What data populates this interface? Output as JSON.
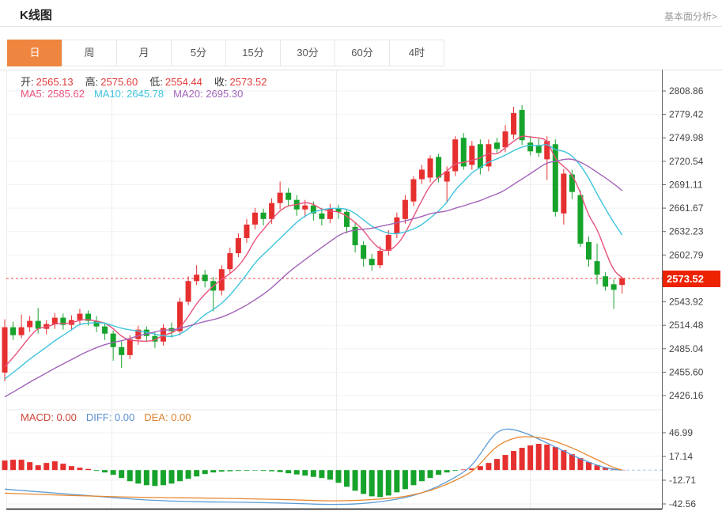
{
  "header": {
    "title": "K线图",
    "link": "基本面分析>"
  },
  "tabs": {
    "items": [
      "日",
      "周",
      "月",
      "5分",
      "15分",
      "30分",
      "60分",
      "4时"
    ],
    "active_index": 0
  },
  "legend": {
    "ohlc": [
      {
        "label": "开:",
        "value": "2565.13"
      },
      {
        "label": "高:",
        "value": "2575.60"
      },
      {
        "label": "低:",
        "value": "2554.44"
      },
      {
        "label": "收:",
        "value": "2573.52"
      }
    ],
    "ma": [
      {
        "label": "MA5:",
        "value": "2585.62",
        "color": "#e8537a"
      },
      {
        "label": "MA10:",
        "value": "2645.78",
        "color": "#3ec4dd"
      },
      {
        "label": "MA20:",
        "value": "2695.30",
        "color": "#a263b8"
      }
    ],
    "macd": [
      {
        "label": "MACD:",
        "value": "0.00",
        "color": "#cf4436"
      },
      {
        "label": "DIFF:",
        "value": "0.00",
        "color": "#5a8fd0"
      },
      {
        "label": "DEA:",
        "value": "0.00",
        "color": "#e0832e"
      }
    ]
  },
  "price_marker": {
    "value": "2573.52"
  },
  "colors": {
    "up": "#e62f2f",
    "down": "#16a32b",
    "ma5": "#e8537a",
    "ma10": "#3ec4dd",
    "ma20": "#a263b8",
    "diff": "#5b9bd5",
    "dea": "#e8872e",
    "price_line": "#ff4242",
    "price_marker_bg": "#ec2200",
    "tab_active_bg": "#ef8640"
  },
  "chart_data": {
    "type": "candlestick",
    "title": "K线图",
    "interval": "日",
    "grid": true,
    "legend_position": "top-left",
    "y_axis_labels_main": [
      "2808.86",
      "2779.42",
      "2749.98",
      "2720.54",
      "2691.11",
      "2661.67",
      "2632.23",
      "2602.79",
      "2573.52",
      "2543.92",
      "2514.48",
      "2485.04",
      "2455.60",
      "2426.16"
    ],
    "y_axis_labels_macd": [
      "46.99",
      "17.14",
      "-12.71",
      "-42.56"
    ],
    "ylim_main": [
      2426.16,
      2808.86
    ],
    "ylim_macd": [
      -42.56,
      46.99
    ],
    "current_price": 2573.52,
    "ohlc_display": {
      "open": 2565.13,
      "high": 2575.6,
      "low": 2554.44,
      "close": 2573.52
    },
    "ma_display": {
      "MA5": 2585.62,
      "MA10": 2645.78,
      "MA20": 2695.3
    },
    "macd_display": {
      "MACD": 0.0,
      "DIFF": 0.0,
      "DEA": 0.0
    },
    "grid_x_positions": [
      141,
      425,
      670
    ],
    "ma_periods": [
      5,
      10,
      20
    ],
    "ma_seed": [
      2380,
      2384,
      2388,
      2392,
      2396,
      2400,
      2404,
      2408,
      2412,
      2416,
      2420,
      2424,
      2428,
      2432,
      2436,
      2440,
      2444,
      2448,
      2452,
      2455
    ],
    "candles": [
      [
        2455,
        2522,
        2444,
        2512
      ],
      [
        2512,
        2519,
        2496,
        2502
      ],
      [
        2502,
        2528,
        2498,
        2512
      ],
      [
        2512,
        2526,
        2506,
        2520
      ],
      [
        2520,
        2536,
        2504,
        2510
      ],
      [
        2510,
        2521,
        2503,
        2516
      ],
      [
        2516,
        2530,
        2510,
        2524
      ],
      [
        2524,
        2529,
        2509,
        2515
      ],
      [
        2515,
        2527,
        2508,
        2521
      ],
      [
        2521,
        2535,
        2515,
        2529
      ],
      [
        2529,
        2533,
        2514,
        2520
      ],
      [
        2520,
        2526,
        2506,
        2513
      ],
      [
        2513,
        2518,
        2496,
        2504
      ],
      [
        2504,
        2508,
        2470,
        2487
      ],
      [
        2487,
        2494,
        2461,
        2477
      ],
      [
        2477,
        2502,
        2472,
        2497
      ],
      [
        2497,
        2514,
        2490,
        2509
      ],
      [
        2509,
        2513,
        2494,
        2501
      ],
      [
        2501,
        2507,
        2486,
        2494
      ],
      [
        2494,
        2516,
        2489,
        2511
      ],
      [
        2511,
        2518,
        2499,
        2507
      ],
      [
        2507,
        2549,
        2502,
        2544
      ],
      [
        2544,
        2576,
        2540,
        2570
      ],
      [
        2570,
        2590,
        2565,
        2578
      ],
      [
        2578,
        2584,
        2562,
        2570
      ],
      [
        2570,
        2575,
        2532,
        2558
      ],
      [
        2558,
        2590,
        2552,
        2585
      ],
      [
        2585,
        2612,
        2580,
        2605
      ],
      [
        2605,
        2630,
        2600,
        2624
      ],
      [
        2624,
        2648,
        2618,
        2641
      ],
      [
        2641,
        2662,
        2635,
        2656
      ],
      [
        2656,
        2661,
        2640,
        2648
      ],
      [
        2648,
        2674,
        2642,
        2668
      ],
      [
        2668,
        2695,
        2660,
        2681
      ],
      [
        2681,
        2687,
        2664,
        2672
      ],
      [
        2672,
        2678,
        2652,
        2660
      ],
      [
        2660,
        2672,
        2650,
        2665
      ],
      [
        2665,
        2670,
        2646,
        2655
      ],
      [
        2655,
        2662,
        2640,
        2648
      ],
      [
        2648,
        2667,
        2643,
        2661
      ],
      [
        2661,
        2666,
        2648,
        2657
      ],
      [
        2657,
        2660,
        2630,
        2638
      ],
      [
        2638,
        2644,
        2606,
        2615
      ],
      [
        2615,
        2620,
        2588,
        2598
      ],
      [
        2598,
        2604,
        2583,
        2590
      ],
      [
        2590,
        2614,
        2586,
        2608
      ],
      [
        2608,
        2634,
        2602,
        2628
      ],
      [
        2630,
        2656,
        2624,
        2650
      ],
      [
        2648,
        2678,
        2642,
        2672
      ],
      [
        2670,
        2702,
        2664,
        2698
      ],
      [
        2698,
        2716,
        2692,
        2710
      ],
      [
        2700,
        2728,
        2694,
        2724
      ],
      [
        2726,
        2730,
        2694,
        2700
      ],
      [
        2695,
        2714,
        2668,
        2708
      ],
      [
        2708,
        2752,
        2702,
        2748
      ],
      [
        2750,
        2756,
        2710,
        2714
      ],
      [
        2716,
        2746,
        2710,
        2740
      ],
      [
        2742,
        2748,
        2704,
        2712
      ],
      [
        2714,
        2748,
        2708,
        2742
      ],
      [
        2744,
        2750,
        2730,
        2736
      ],
      [
        2738,
        2766,
        2732,
        2758
      ],
      [
        2754,
        2789,
        2748,
        2781
      ],
      [
        2785,
        2791,
        2741,
        2747
      ],
      [
        2744,
        2752,
        2728,
        2733
      ],
      [
        2741,
        2749,
        2726,
        2731
      ],
      [
        2723,
        2752,
        2697,
        2746
      ],
      [
        2742,
        2748,
        2651,
        2657
      ],
      [
        2655,
        2711,
        2641,
        2705
      ],
      [
        2704,
        2710,
        2673,
        2682
      ],
      [
        2678,
        2684,
        2613,
        2617
      ],
      [
        2619,
        2626,
        2588,
        2597
      ],
      [
        2595,
        2617,
        2566,
        2578
      ],
      [
        2576,
        2581,
        2558,
        2563
      ],
      [
        2566,
        2572,
        2535,
        2559
      ],
      [
        2565.13,
        2575.6,
        2554.44,
        2573.52
      ]
    ],
    "macd": {
      "hist": [
        12,
        13,
        13,
        10,
        6,
        9,
        11,
        8,
        5,
        3,
        1.5,
        -1,
        -3,
        -6,
        -10,
        -14,
        -17,
        -19,
        -20,
        -19,
        -17,
        -14,
        -11,
        -8,
        -5,
        -3,
        -2,
        -1.5,
        -1,
        -0.8,
        -0.6,
        -1,
        -1.5,
        -2.5,
        -4,
        -5.5,
        -7,
        -8.5,
        -10,
        -12,
        -16,
        -21,
        -26,
        -30,
        -33,
        -34,
        -32,
        -28,
        -24,
        -19,
        -14,
        -10,
        -6,
        -3,
        -1,
        0.8,
        2,
        5,
        9,
        14,
        19,
        24,
        28,
        31,
        33,
        32,
        29,
        25,
        20,
        15,
        10,
        6,
        3,
        1,
        0.1
      ],
      "diff_points": [
        [
          1,
          -24
        ],
        [
          6,
          -28
        ],
        [
          12,
          -33
        ],
        [
          18,
          -38
        ],
        [
          24,
          -40
        ],
        [
          30,
          -40.5
        ],
        [
          36,
          -42
        ],
        [
          40,
          -43.5
        ],
        [
          44,
          -42.5
        ],
        [
          48,
          -37
        ],
        [
          50,
          -32
        ],
        [
          52,
          -25
        ],
        [
          54,
          -15
        ],
        [
          56,
          -3
        ],
        [
          57,
          6
        ],
        [
          58,
          20
        ],
        [
          59,
          36
        ],
        [
          60,
          48
        ],
        [
          61,
          52
        ],
        [
          62,
          51
        ],
        [
          63,
          48
        ],
        [
          64,
          44
        ],
        [
          65,
          39
        ],
        [
          66,
          34
        ],
        [
          67,
          29
        ],
        [
          68,
          24
        ],
        [
          69,
          19
        ],
        [
          70,
          14
        ],
        [
          71,
          10
        ],
        [
          72,
          6
        ],
        [
          73,
          3
        ],
        [
          74,
          1
        ],
        [
          75,
          0
        ]
      ],
      "dea_points": [
        [
          1,
          -29
        ],
        [
          6,
          -31
        ],
        [
          12,
          -33
        ],
        [
          18,
          -34.5
        ],
        [
          24,
          -35
        ],
        [
          30,
          -36
        ],
        [
          36,
          -37.5
        ],
        [
          40,
          -39
        ],
        [
          44,
          -38
        ],
        [
          48,
          -35
        ],
        [
          50,
          -31
        ],
        [
          52,
          -26
        ],
        [
          54,
          -18
        ],
        [
          56,
          -8
        ],
        [
          57,
          -2
        ],
        [
          58,
          8
        ],
        [
          59,
          20
        ],
        [
          60,
          30
        ],
        [
          61,
          36
        ],
        [
          62,
          40
        ],
        [
          63,
          42
        ],
        [
          64,
          42
        ],
        [
          65,
          41
        ],
        [
          66,
          39
        ],
        [
          67,
          36
        ],
        [
          68,
          32
        ],
        [
          69,
          28
        ],
        [
          70,
          23
        ],
        [
          71,
          18
        ],
        [
          72,
          13
        ],
        [
          73,
          8
        ],
        [
          74,
          3
        ],
        [
          75,
          0
        ]
      ]
    }
  }
}
